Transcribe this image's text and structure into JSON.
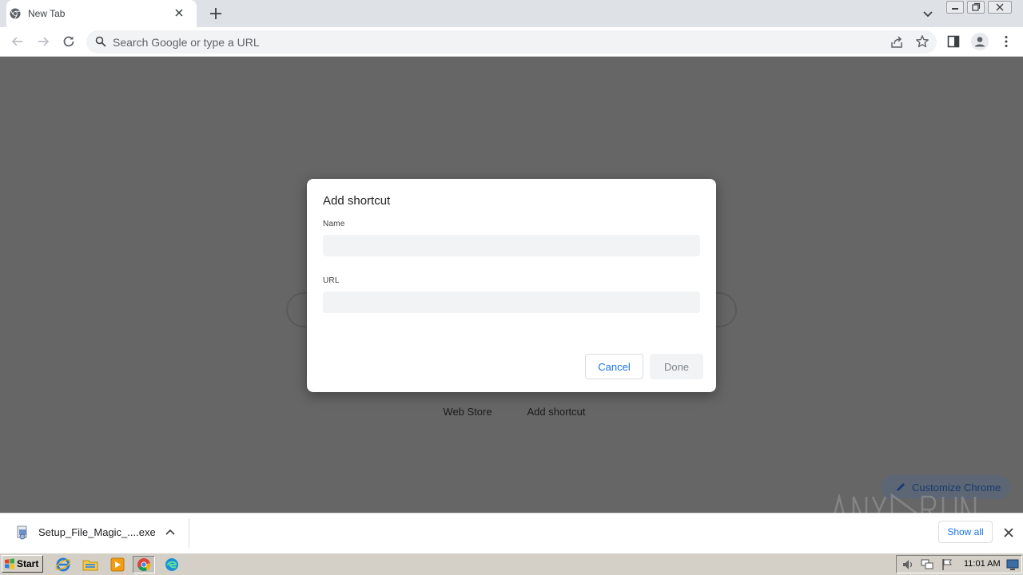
{
  "browser": {
    "tab": {
      "title": "New Tab"
    },
    "omnibox": {
      "placeholder": "Search Google or type a URL"
    },
    "icons": [
      "chrome-icon",
      "close-icon",
      "plus-icon",
      "chevron-down-icon",
      "back-arrow-icon",
      "forward-arrow-icon",
      "reload-icon",
      "search-icon",
      "share-icon",
      "star-icon",
      "side-panel-icon",
      "profile-icon",
      "more-vert-icon"
    ]
  },
  "new_tab_page": {
    "shortcuts": [
      {
        "label": "Web Store"
      },
      {
        "label": "Add shortcut"
      }
    ],
    "customize_label": "Customize Chrome",
    "watermark": "ANY RUN"
  },
  "dialog": {
    "title": "Add shortcut",
    "name_label": "Name",
    "name_value": "",
    "url_label": "URL",
    "url_value": "",
    "cancel_label": "Cancel",
    "done_label": "Done"
  },
  "download_shelf": {
    "filename": "Setup_File_Magic_....exe",
    "show_all_label": "Show all"
  },
  "taskbar": {
    "start_label": "Start",
    "clock": "11:01 AM",
    "apps": [
      "internet-explorer-icon",
      "file-explorer-icon",
      "media-player-icon",
      "chrome-icon",
      "edge-icon"
    ]
  },
  "colors": {
    "accent": "#1a73e8",
    "overlay": "#666666",
    "tabstrip": "#dee1e6",
    "taskbar": "#d4d0c8"
  }
}
